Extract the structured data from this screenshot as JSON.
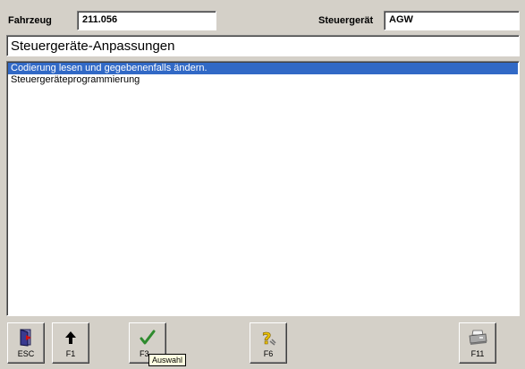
{
  "header": {
    "vehicle_label": "Fahrzeug",
    "vehicle_value": "211.056",
    "ecu_label": "Steuergerät",
    "ecu_value": "AGW"
  },
  "title": "Steuergeräte-Anpassungen",
  "list": {
    "items": [
      {
        "label": "Codierung lesen und gegebenenfalls ändern.",
        "selected": true
      },
      {
        "label": "Steuergeräteprogrammierung",
        "selected": false
      }
    ]
  },
  "fkeys": {
    "esc": {
      "label": "ESC",
      "icon": "exit-door-icon"
    },
    "f1": {
      "label": "F1",
      "icon": "arrow-up-icon"
    },
    "f3": {
      "label": "F3",
      "icon": "checkmark-icon"
    },
    "f6": {
      "label": "F6",
      "icon": "help-question-icon"
    },
    "f11": {
      "label": "F11",
      "icon": "printer-icon"
    }
  },
  "tooltip": "Auswahl",
  "colors": {
    "background": "#d4d0c8",
    "selection": "#3169c6",
    "checkmark": "#2e8b2e",
    "help_icon": "#e8c000",
    "tooltip_bg": "#ffffe1"
  }
}
